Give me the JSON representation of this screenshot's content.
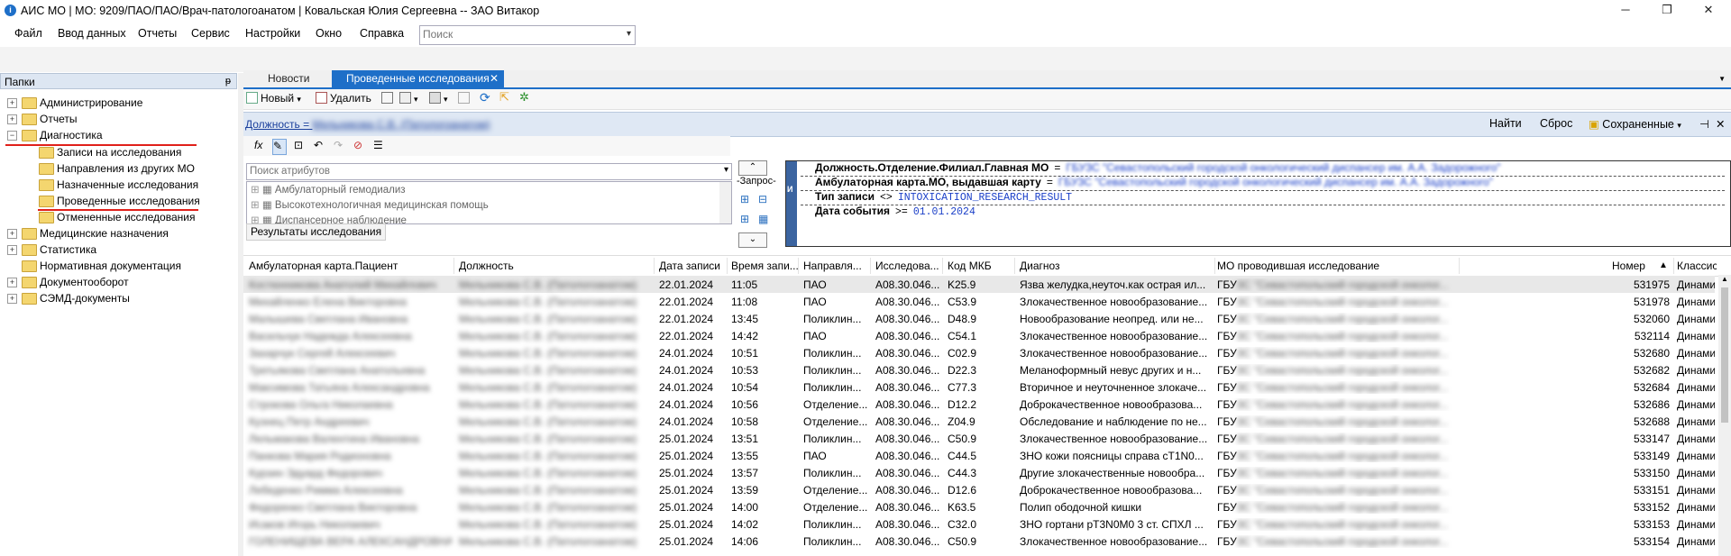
{
  "window": {
    "title": "АИС МО | МО: 9209/ПАО/ПАО/Врач-патологоанатом | Ковальская Юлия Сергеевна -- ЗАО Витакор",
    "app_icon_letter": "i",
    "controls": [
      "─",
      "❐",
      "✕"
    ]
  },
  "menu": {
    "items": [
      "Файл",
      "Ввод данных",
      "Отчеты",
      "Сервис",
      "Настройки",
      "Окно",
      "Справка"
    ],
    "search_placeholder": "Поиск"
  },
  "folders": {
    "title": "Папки",
    "pin": "ᵽ",
    "nodes": [
      {
        "label": "Администрирование",
        "expander": "+"
      },
      {
        "label": "Отчеты",
        "expander": "+"
      },
      {
        "label": "Диагностика",
        "expander": "−"
      },
      {
        "label": "Записи на исследования"
      },
      {
        "label": "Направления из других МО"
      },
      {
        "label": "Назначенные исследования"
      },
      {
        "label": "Проведенные исследования"
      },
      {
        "label": "Отмененные исследования"
      },
      {
        "label": "Медицинские назначения",
        "expander": "+"
      },
      {
        "label": "Статистика",
        "expander": "+"
      },
      {
        "label": "Нормативная документация"
      },
      {
        "label": "Документооборот",
        "expander": "+"
      },
      {
        "label": "СЭМД-документы",
        "expander": "+"
      }
    ]
  },
  "tabs": [
    {
      "label": "Новости"
    },
    {
      "label": "Проведенные исследования",
      "close": "✕"
    }
  ],
  "toolbar": {
    "new_label": "Новый",
    "delete_label": "Удалить"
  },
  "filterbar": {
    "link_prefix": "Должность = ",
    "link_value": "Мельникова С.В. (Патологоанатом)",
    "find_label": "Найти",
    "reset_label": "Сброс",
    "saved_label": "Сохраненные"
  },
  "filter_editor": {
    "attr_search_placeholder": "Поиск атрибутов",
    "attributes": [
      "Амбулаторный гемодиализ",
      "Высокотехнологичная медицинская помощь",
      "Диспансерное наблюдение"
    ],
    "query_label": "-Запрос-",
    "results_tab": "Результаты исследования",
    "conditions": [
      {
        "field": "Должность.Отделение.Филиал.Главная МО",
        "op": "=",
        "value": "ГБУЗС \"Севастопольский городской онкологический диспансер им. А.А. Задорожного\""
      },
      {
        "field": "Амбулаторная карта.МО, выдавшая карту",
        "op": "=",
        "value": "ГБУЗС \"Севастопольский городской онкологический диспансер им. А.А. Задорожного\""
      },
      {
        "field": "Тип записи",
        "op": "<>",
        "value": "INTOXICATION_RESEARCH_RESULT"
      },
      {
        "field": "Дата события",
        "op": ">=",
        "value": "01.01.2024"
      }
    ]
  },
  "grid": {
    "columns": [
      "Амбулаторная карта.Пациент",
      "Должность",
      "Дата записи",
      "Время запи...",
      "Направля...",
      "Исследова...",
      "Код МКБ",
      "Диагноз",
      "МО проводившая исследование",
      "Номер",
      "Классис"
    ],
    "sort_indicator": "▲",
    "rows": [
      [
        "Костюнникова Анатолий Михайлович",
        "Мельникова С.В. (Патологоанатом)",
        "22.01.2024",
        "11:05",
        "ПАО",
        "A08.30.046....",
        "K25.9",
        "Язва желудка,неуточ.как острая ил...",
        "ГБУЗС \"Севастопольский городской онколог...",
        "531975",
        "Динами"
      ],
      [
        "Михайленко Елена Викторовна",
        "Мельникова С.В. (Патологоанатом)",
        "22.01.2024",
        "11:08",
        "ПАО",
        "A08.30.046....",
        "C53.9",
        "Злокачественное новообразование...",
        "ГБУЗС \"Севастопольский городской онколог...",
        "531978",
        "Динами"
      ],
      [
        "Малышева Светлана Ивановна",
        "Мельникова С.В. (Патологоанатом)",
        "22.01.2024",
        "13:45",
        "Поликлин...",
        "A08.30.046....",
        "D48.9",
        "Новообразование неопред. или не...",
        "ГБУЗС \"Севастопольский городской онколог...",
        "532060",
        "Динами"
      ],
      [
        "Васильчук Надежда Алексеевна",
        "Мельникова С.В. (Патологоанатом)",
        "22.01.2024",
        "14:42",
        "ПАО",
        "A08.30.046....",
        "C54.1",
        "Злокачественное новообразование...",
        "ГБУЗС \"Севастопольский городской онколог...",
        "532114",
        "Динами"
      ],
      [
        "Захарчук Сергей Алексеевич",
        "Мельникова С.В. (Патологоанатом)",
        "24.01.2024",
        "10:51",
        "Поликлин...",
        "A08.30.046....",
        "C02.9",
        "Злокачественное новообразование...",
        "ГБУЗС \"Севастопольский городской онколог...",
        "532680",
        "Динами"
      ],
      [
        "Третьякова Светлана Анатольевна",
        "Мельникова С.В. (Патологоанатом)",
        "24.01.2024",
        "10:53",
        "Поликлин...",
        "A08.30.046....",
        "D22.3",
        "Меланоформный невус других и н...",
        "ГБУЗС \"Севастопольский городской онколог...",
        "532682",
        "Динами"
      ],
      [
        "Максимова Татьяна Александровна",
        "Мельникова С.В. (Патологоанатом)",
        "24.01.2024",
        "10:54",
        "Поликлин...",
        "A08.30.046....",
        "C77.3",
        "Вторичное и неуточненное злокаче...",
        "ГБУЗС \"Севастопольский городской онколог...",
        "532684",
        "Динами"
      ],
      [
        "Строкова Ольга Николаевна",
        "Мельникова С.В. (Патологоанатом)",
        "24.01.2024",
        "10:56",
        "Отделение...",
        "A08.30.046....",
        "D12.2",
        "Доброкачественное новообразова...",
        "ГБУЗС \"Севастопольский городской онколог...",
        "532686",
        "Динами"
      ],
      [
        "Кузнец Петр Андреевич",
        "Мельникова С.В. (Патологоанатом)",
        "24.01.2024",
        "10:58",
        "Отделение...",
        "A08.30.046....",
        "Z04.9",
        "Обследование и наблюдение по не...",
        "ГБУЗС \"Севастопольский городской онколог...",
        "532688",
        "Динами"
      ],
      [
        "Лельмакова Валентина Ивановна",
        "Мельникова С.В. (Патологоанатом)",
        "25.01.2024",
        "13:51",
        "Поликлин...",
        "A08.30.046....",
        "C50.9",
        "Злокачественное новообразование...",
        "ГБУЗС \"Севастопольский городской онколог...",
        "533147",
        "Динами"
      ],
      [
        "Панкова Мария Родионовна",
        "Мельникова С.В. (Патологоанатом)",
        "25.01.2024",
        "13:55",
        "ПАО",
        "A08.30.046....",
        "C44.5",
        "ЗНО кожи поясницы справа cT1N0...",
        "ГБУЗС \"Севастопольский городской онколог...",
        "533149",
        "Динами"
      ],
      [
        "Курзин Эдуард Федорович",
        "Мельникова С.В. (Патологоанатом)",
        "25.01.2024",
        "13:57",
        "Поликлин...",
        "A08.30.046....",
        "C44.3",
        "Другие злокачественные новообра...",
        "ГБУЗС \"Севастопольский городской онколог...",
        "533150",
        "Динами"
      ],
      [
        "Лебеденко Римма Алексеевна",
        "Мельникова С.В. (Патологоанатом)",
        "25.01.2024",
        "13:59",
        "Отделение...",
        "A08.30.046....",
        "D12.6",
        "Доброкачественное новообразова...",
        "ГБУЗС \"Севастопольский городской онколог...",
        "533151",
        "Динами"
      ],
      [
        "Федоренко Светлана Викторовна",
        "Мельникова С.В. (Патологоанатом)",
        "25.01.2024",
        "14:00",
        "Отделение...",
        "A08.30.046....",
        "K63.5",
        "Полип ободочной кишки",
        "ГБУЗС \"Севастопольский городской онколог...",
        "533152",
        "Динами"
      ],
      [
        "Исаков Игорь Николаевич",
        "Мельникова С.В. (Патологоанатом)",
        "25.01.2024",
        "14:02",
        "Поликлин...",
        "A08.30.046....",
        "C32.0",
        " ЗНО гортани pT3N0M0 3 ст. СПХЛ ...",
        "ГБУЗС \"Севастопольский городской онколог...",
        "533153",
        "Динами"
      ],
      [
        "ГОЛЕНИЩЕВА ВЕРА АЛЕКСАНДРОВНА",
        "Мельникова С.В. (Патологоанатом)",
        "25.01.2024",
        "14:06",
        "Поликлин...",
        "A08.30.046....",
        "C50.9",
        "Злокачественное новообразование...",
        "ГБУЗС \"Севастопольский городской онколог...",
        "533154",
        "Динами"
      ]
    ]
  }
}
